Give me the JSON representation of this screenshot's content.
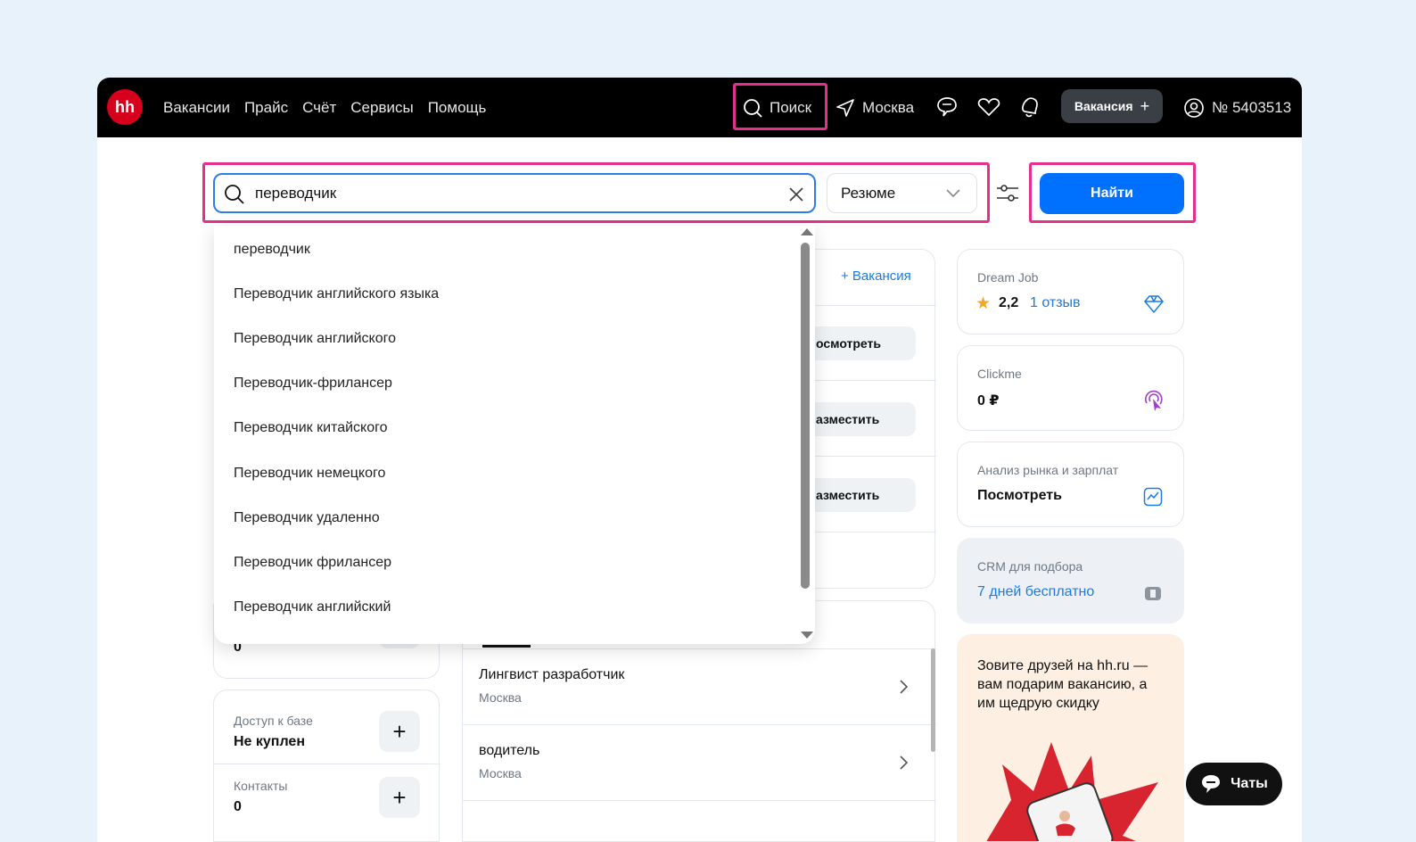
{
  "header": {
    "logo": "hh",
    "nav": [
      "Вакансии",
      "Прайс",
      "Счёт",
      "Сервисы",
      "Помощь"
    ],
    "search_label": "Поиск",
    "city": "Москва",
    "vacancy_button": "Вакансия",
    "account": "№ 5403513"
  },
  "search": {
    "query": "переводчик",
    "type_select": "Резюме",
    "find_button": "Найти"
  },
  "suggestions": [
    "переводчик",
    "Переводчик английского языка",
    "Переводчик английского",
    "Переводчик-фрилансер",
    "Переводчик китайского",
    "Переводчик немецкого",
    "Переводчик удаленно",
    "Переводчик фрилансер",
    "Переводчик английский"
  ],
  "middle": {
    "add_vacancy": "+ Вакансия",
    "actions": [
      "осмотреть",
      "азместить",
      "азместить"
    ],
    "vacancies": [
      {
        "title": "Лингвист разработчик",
        "city": "Москва"
      },
      {
        "title": "водитель",
        "city": "Москва"
      }
    ]
  },
  "left": {
    "zero_top": "0",
    "base_access": {
      "label": "Доступ к базе",
      "value": "Не куплен"
    },
    "contacts": {
      "label": "Контакты",
      "value": "0"
    }
  },
  "right": {
    "dreamjob": {
      "title": "Dream Job",
      "rating": "2,2",
      "reviews": "1 отзыв"
    },
    "clickme": {
      "title": "Clickme",
      "value": "0 ₽"
    },
    "analysis": {
      "title": "Анализ рынка и зарплат",
      "action": "Посмотреть"
    },
    "crm": {
      "title": "CRM для подбора",
      "link": "7 дней бесплатно"
    },
    "promo": "Зовите друзей на hh.ru — вам подарим вакансию, а им щедрую скидку"
  },
  "chat_button": "Чаты",
  "colors": {
    "accent": "#0070ff",
    "highlight": "#e62e8c",
    "brand": "#d6001c"
  }
}
